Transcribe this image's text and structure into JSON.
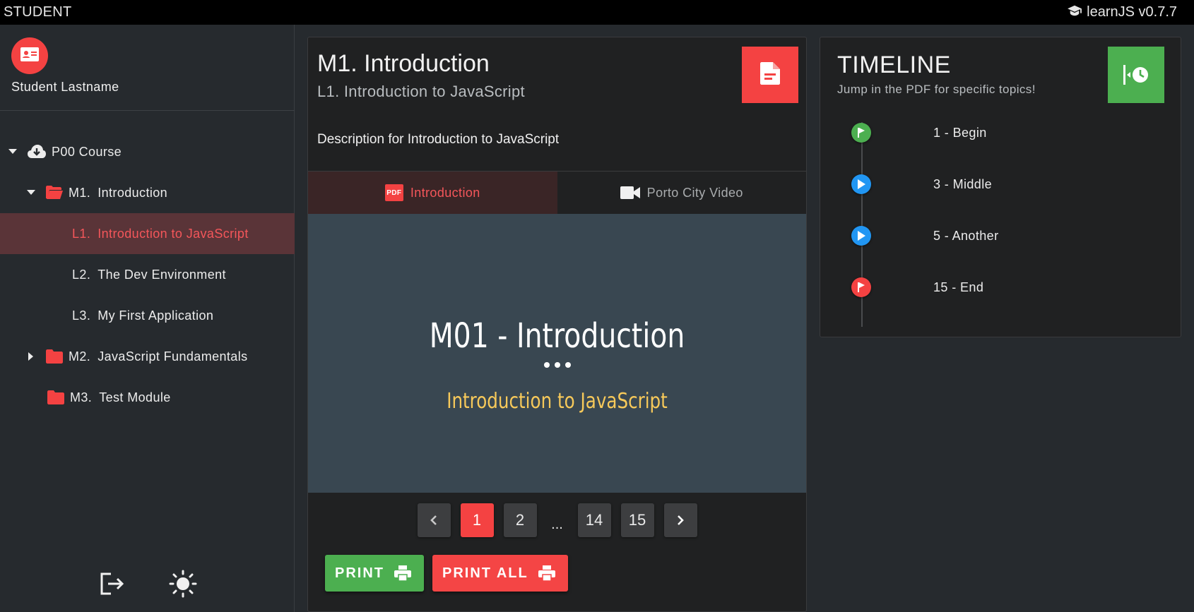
{
  "topbar": {
    "role": "STUDENT",
    "app_name": "learnJS v0.7.7"
  },
  "user": {
    "name": "Student Lastname"
  },
  "tree": {
    "course": {
      "label": "P00 Course"
    },
    "modules": [
      {
        "num": "M1.",
        "label": "Introduction"
      },
      {
        "num": "M2.",
        "label": "JavaScript Fundamentals"
      },
      {
        "num": "M3.",
        "label": "Test Module"
      }
    ],
    "lessons": [
      {
        "num": "L1.",
        "label": "Introduction to JavaScript"
      },
      {
        "num": "L2.",
        "label": "The Dev Environment"
      },
      {
        "num": "L3.",
        "label": "My First Application"
      }
    ]
  },
  "main": {
    "title": "M1. Introduction",
    "subtitle": "L1. Introduction to JavaScript",
    "description": "Description for Introduction to JavaScript",
    "tabs": [
      {
        "label": "Introduction",
        "icon": "pdf-icon",
        "badge": "PDF"
      },
      {
        "label": "Porto City Video",
        "icon": "video-camera-icon"
      }
    ],
    "slide": {
      "title": "M01 - Introduction",
      "subtitle": "Introduction to JavaScript"
    },
    "pager": {
      "pages": [
        "1",
        "2",
        "...",
        "14",
        "15"
      ],
      "current": "1"
    },
    "print_label": "PRINT",
    "print_all_label": "PRINT ALL"
  },
  "timeline": {
    "title": "TIMELINE",
    "subtitle": "Jump in the PDF for specific topics!",
    "items": [
      {
        "label": "1 - Begin",
        "color": "#4caf50",
        "icon": "flag-icon"
      },
      {
        "label": "3 - Middle",
        "color": "#2196f3",
        "icon": "play-icon"
      },
      {
        "label": "5 - Another",
        "color": "#2196f3",
        "icon": "play-icon"
      },
      {
        "label": "15 - End",
        "color": "#f44242",
        "icon": "flag-icon"
      }
    ]
  },
  "colors": {
    "accent": "#f44242",
    "success": "#4caf50",
    "info": "#2196f3",
    "slide_bg": "#394751",
    "slide_subtitle": "#f7c95a"
  }
}
